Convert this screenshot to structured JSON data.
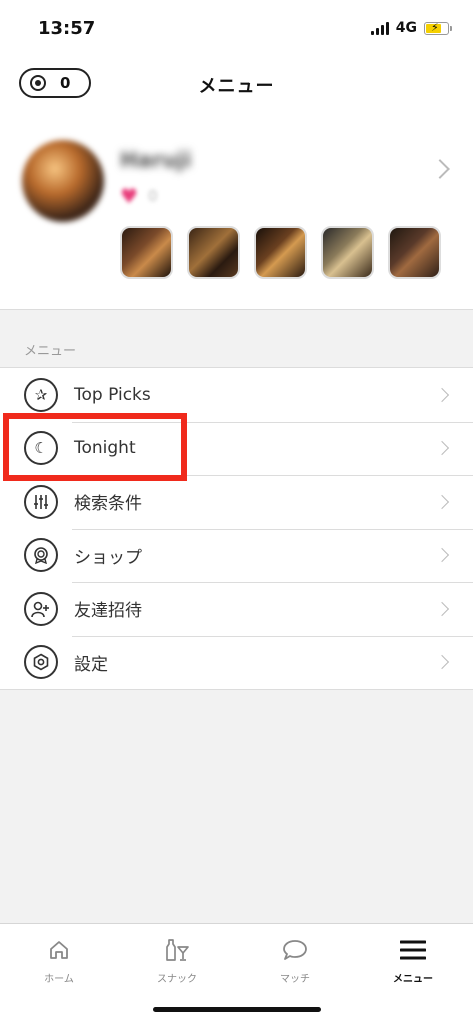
{
  "status_bar": {
    "time": "13:57",
    "network": "4G"
  },
  "header": {
    "title": "メニュー",
    "coin_count": "0"
  },
  "profile": {
    "name": "Haruji",
    "likes": "0",
    "photos": [
      "bar-interior-1",
      "bar-interior-2",
      "bar-interior-3",
      "bar-interior-4",
      "bar-interior-5"
    ]
  },
  "menu": {
    "section_label": "メニュー",
    "items": [
      {
        "label": "Top Picks",
        "icon": "laurel-stars-icon"
      },
      {
        "label": "Tonight",
        "icon": "moon-stars-icon"
      },
      {
        "label": "検索条件",
        "icon": "sliders-icon"
      },
      {
        "label": "ショップ",
        "icon": "badge-icon"
      },
      {
        "label": "友達招待",
        "icon": "add-friend-icon"
      },
      {
        "label": "設定",
        "icon": "hex-settings-icon"
      }
    ]
  },
  "tab_bar": {
    "tabs": [
      {
        "label": "ホーム",
        "icon": "home-icon"
      },
      {
        "label": "スナック",
        "icon": "drinks-icon"
      },
      {
        "label": "マッチ",
        "icon": "chat-bubble-icon"
      },
      {
        "label": "メニュー",
        "icon": "hamburger-icon",
        "active": true
      }
    ]
  },
  "colors": {
    "highlight": "#f02a1c",
    "heart": "#e83c7a",
    "battery": "#f5d000"
  }
}
